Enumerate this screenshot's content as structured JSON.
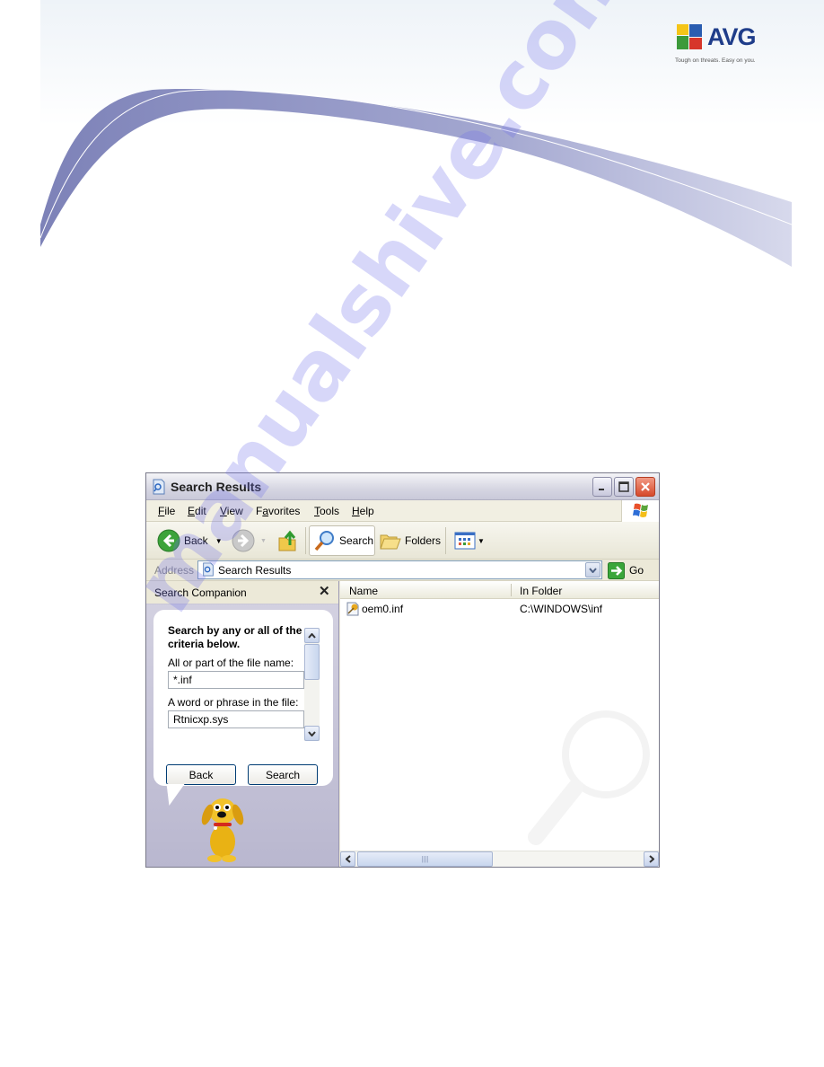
{
  "brand": {
    "name": "AVG",
    "tagline": "Tough on threats. Easy on you.",
    "colors": {
      "logo_text": "#1f3d8a",
      "swoosh": "#8a8fc0"
    }
  },
  "window": {
    "title": "Search Results",
    "controls": {
      "minimize": "minimize",
      "maximize": "maximize",
      "close": "close"
    }
  },
  "menu": {
    "items": [
      {
        "label": "File",
        "accel": "F",
        "rest": "ile"
      },
      {
        "label": "Edit",
        "accel": "E",
        "rest": "dit"
      },
      {
        "label": "View",
        "accel": "V",
        "rest": "iew"
      },
      {
        "label": "Favorites",
        "pre": "F",
        "accel": "a",
        "rest": "vorites"
      },
      {
        "label": "Tools",
        "accel": "T",
        "rest": "ools"
      },
      {
        "label": "Help",
        "accel": "H",
        "rest": "elp"
      }
    ]
  },
  "toolbar": {
    "back_label": "Back",
    "search_label": "Search",
    "folders_label": "Folders"
  },
  "address": {
    "label": "Address",
    "value": "Search Results",
    "go_label": "Go"
  },
  "companion": {
    "title": "Search Companion",
    "heading": "Search by any or all of the criteria below.",
    "filename_label": "All or part of the file name:",
    "filename_value": "*.inf",
    "phrase_label": "A word or phrase in the file:",
    "phrase_value": "Rtnicxp.sys",
    "back_button": "Back",
    "search_button": "Search"
  },
  "results": {
    "columns": [
      "Name",
      "In Folder"
    ],
    "rows": [
      {
        "name": "oem0.inf",
        "folder": "C:\\WINDOWS\\inf"
      }
    ]
  },
  "watermark": "manualshive.com"
}
